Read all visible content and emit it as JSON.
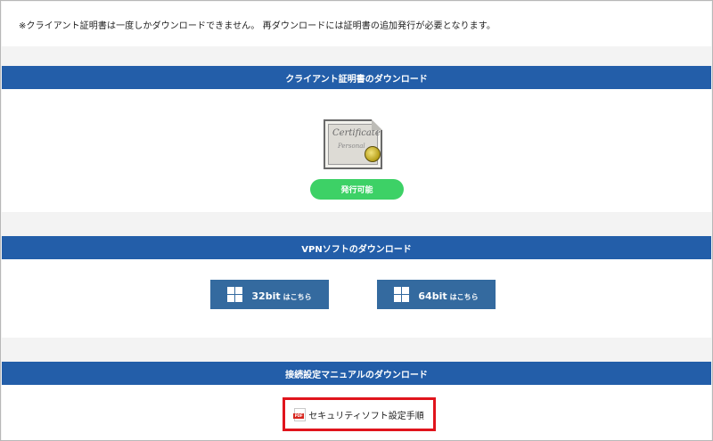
{
  "notice": "※クライアント証明書は一度しかダウンロードできません。 再ダウンロードには証明書の追加発行が必要となります。",
  "cert_section": {
    "header": "クライアント証明書のダウンロード",
    "certificate_title": "Certificate",
    "certificate_subtitle": "Personal",
    "issue_button": "発行可能"
  },
  "vpn_section": {
    "header": "VPNソフトのダウンロード",
    "buttons": [
      {
        "label": "32bit",
        "suffix": "はこちら",
        "icon": "windows-icon"
      },
      {
        "label": "64bit",
        "suffix": "はこちら",
        "icon": "windows-icon"
      }
    ]
  },
  "manual_section": {
    "header": "接続設定マニュアルのダウンロード",
    "link": "セキュリティソフト設定手順",
    "icon": "pdf-icon",
    "pdf_badge": "PDF"
  },
  "colors": {
    "header_bar": "#235ea9",
    "issue_button": "#3dd166",
    "download_button": "#346a9f",
    "highlight": "#e0141c",
    "background": "#f3f3f3"
  }
}
